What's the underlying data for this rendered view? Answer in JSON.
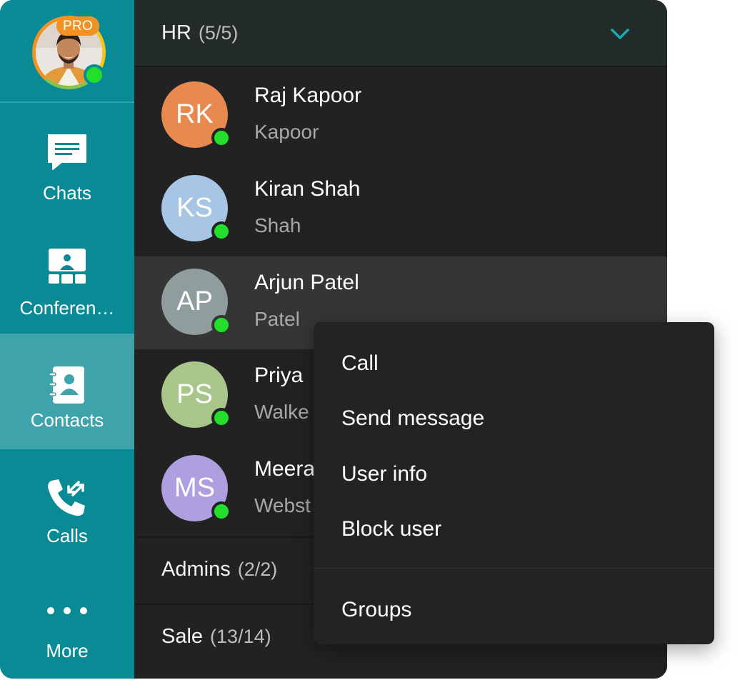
{
  "profile": {
    "badge": "PRO",
    "colors": {
      "ring_yellow": "#f7c51b",
      "ring_green": "#8bc34a",
      "ring_orange": "#f39224",
      "presence": "#22e02a"
    }
  },
  "sidebar": {
    "background": "#0a8a95",
    "active_background": "#3fa3ac",
    "items": [
      {
        "label": "Chats",
        "icon": "chat-bubble-icon",
        "active": false
      },
      {
        "label": "Conferen…",
        "icon": "conference-icon",
        "active": false
      },
      {
        "label": "Contacts",
        "icon": "contacts-book-icon",
        "active": true
      },
      {
        "label": "Calls",
        "icon": "phone-calls-icon",
        "active": false
      },
      {
        "label": "More",
        "icon": "more-dots-icon",
        "active": false
      }
    ]
  },
  "groups": {
    "hr": {
      "name": "HR",
      "count": "(5/5)",
      "expanded": true
    },
    "admins": {
      "name": "Admins",
      "count": "(2/2)"
    },
    "sale": {
      "name": "Sale",
      "count": "(13/14)"
    }
  },
  "contacts": [
    {
      "initials": "RK",
      "name": "Raj Kapoor",
      "sub": "Kapoor",
      "color": "#e8894f",
      "online": true
    },
    {
      "initials": "KS",
      "name": "Kiran Shah",
      "sub": "Shah",
      "color": "#a7c6e6",
      "online": true
    },
    {
      "initials": "AP",
      "name": "Arjun Patel",
      "sub": "Patel",
      "color": "#8f9e9c",
      "online": true
    },
    {
      "initials": "PS",
      "name": "Priya",
      "sub": "Walke",
      "color": "#a8c68a",
      "online": true
    },
    {
      "initials": "MS",
      "name": "Meera",
      "sub": "Webst",
      "color": "#ad9fe0",
      "online": true
    }
  ],
  "context_menu": {
    "items": [
      "Call",
      "Send message",
      "User info",
      "Block user"
    ],
    "footer_item": "Groups"
  },
  "colors": {
    "accent": "#0a8a95",
    "chevron": "#1aa9b3",
    "panel": "#222222"
  }
}
